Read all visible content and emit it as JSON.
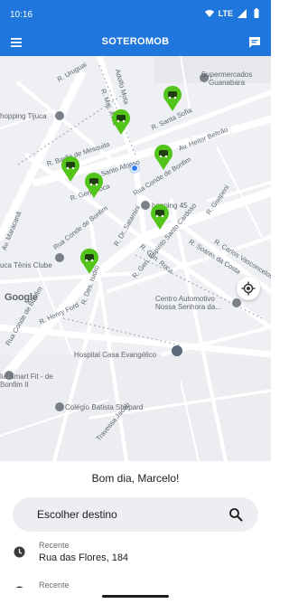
{
  "status_bar": {
    "time": "10:16",
    "network": "LTE"
  },
  "app_bar": {
    "title": "SOTEROMOB",
    "menu_icon": "hamburger-menu-icon",
    "chat_icon": "chat-bubble-icon"
  },
  "map": {
    "streets": [
      "Av. Maracanã",
      "R. Uruguai",
      "R. Maj. Ávila",
      "Adolfo Mota",
      "R. Santa Sofia",
      "Av. Heitor Beltrão",
      "R. Barão de Mesquita",
      "Santo Afonso",
      "R. Gen. Roca",
      "Rua Conde de Bonfim",
      "Rua Conde de Bonfim",
      "R. Gen. Roca",
      "R. Dr. Satamini",
      "R. Guapeni",
      "R. Gen. Espírito Santo Cardoso",
      "R. Soares da Costa",
      "R. Carlos Vasconcelos",
      "Rua Conde de Bonfim",
      "R. Henry Ford",
      "R. Des. Isidro",
      "Travessa Jacob"
    ],
    "pois": {
      "supermarket": "Supermercados Guanabara",
      "shopping_tijuca": "hopping Tijuca",
      "shopping_45": "hopping 45",
      "tennis_club": "uca Tênis Clube",
      "auto_center": "Centro Automotivo Nossa Senhora da...",
      "hospital": "Hospital Casa Evangélico",
      "gym": "lia Smart Fit - de Bonfim II",
      "school": "Colégio Batista Shepard"
    },
    "attribution": "Google"
  },
  "sheet": {
    "greeting": "Bom dia, Marcelo!",
    "search_placeholder": "Escolher destino",
    "recent": [
      {
        "label": "Recente",
        "address": "Rua das Flores, 184"
      },
      {
        "label": "Recente",
        "address": ""
      }
    ]
  },
  "colors": {
    "primary": "#1f76dc",
    "car_marker": "#52c41a",
    "map_background": "#eef0f3"
  }
}
